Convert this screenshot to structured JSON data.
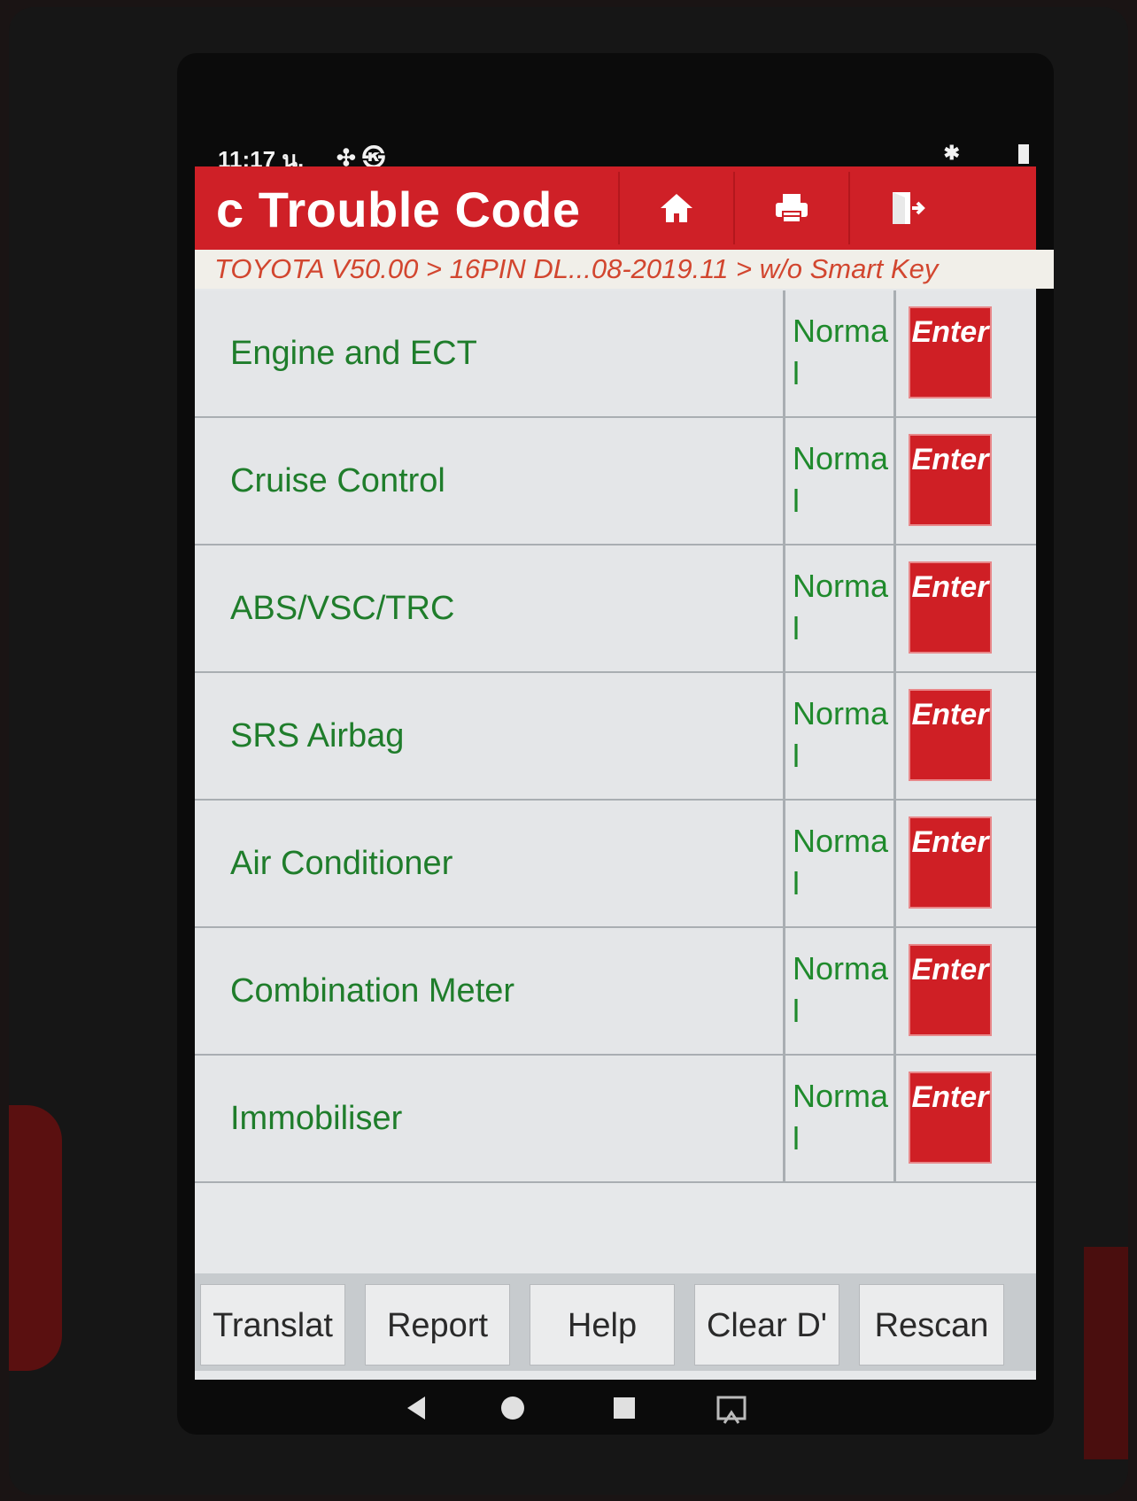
{
  "status_bar": {
    "time": "11:17 น.",
    "icons": "✣ ㉿"
  },
  "header": {
    "title": "c Trouble Code",
    "accent_color": "#cf2027",
    "buttons": [
      {
        "icon": "home-icon"
      },
      {
        "icon": "print-icon"
      },
      {
        "icon": "exit-icon"
      }
    ]
  },
  "breadcrumb": "TOYOTA V50.00 > 16PIN DL...08-2019.11 > w/o Smart Key",
  "systems": [
    {
      "name": "Engine and ECT",
      "status": "Normal",
      "action": "Enter"
    },
    {
      "name": "Cruise Control",
      "status": "Normal",
      "action": "Enter"
    },
    {
      "name": "ABS/VSC/TRC",
      "status": "Normal",
      "action": "Enter"
    },
    {
      "name": "SRS Airbag",
      "status": "Normal",
      "action": "Enter"
    },
    {
      "name": "Air Conditioner",
      "status": "Normal",
      "action": "Enter"
    },
    {
      "name": "Combination Meter",
      "status": "Normal",
      "action": "Enter"
    },
    {
      "name": "Immobiliser",
      "status": "Normal",
      "action": "Enter"
    }
  ],
  "bottom_bar": {
    "translate": "Translat",
    "report": "Report",
    "help": "Help",
    "clear": "Clear D'",
    "rescan": "Rescan"
  },
  "nav": {
    "back": "back-icon",
    "home": "circle-home-icon",
    "recent": "recent-apps-icon",
    "screenshot": "screenshot-icon"
  }
}
